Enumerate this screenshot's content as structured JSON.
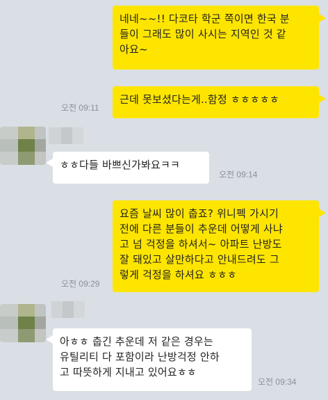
{
  "messages": [
    {
      "sender": "me",
      "text": "네네~~!! 다코타 학군 쪽이면 한국 분\n들이 그래도 많이 사시는 지역인 것 같\n아요~",
      "time": ""
    },
    {
      "sender": "me",
      "text": "근데 못보셨다는게..함정 ㅎㅎㅎㅎㅎ",
      "time": "오전 09:11"
    },
    {
      "sender": "them",
      "text": "ㅎㅎ다들 바쁘신가봐요ㅋㅋ",
      "time": "오전 09:14"
    },
    {
      "sender": "me",
      "text": "요즘 날씨 많이 춥죠? 위니펙 가시기\n전에 다른 분들이 추운데 어떻게 사냐\n고 넘 걱정을 하셔서~ 아파트 난방도\n잘 돼있고 살만하다고 안내드려도 그\n렇게 걱정을 하셔요 ㅎㅎㅎ",
      "time": "오전 09:29"
    },
    {
      "sender": "them",
      "text": "아ㅎㅎ 춥긴 추운데 저 같은 경우는\n유틸리티 다 포함이라 난방걱정 안하\n고 따뜻하게 지내고 있어요ㅎㅎ",
      "time": "오전 09:34"
    }
  ],
  "colors": {
    "background": "#d9dfe4",
    "my_bubble": "#fee500",
    "their_bubble": "#ffffff",
    "text": "#222222",
    "timestamp": "#8a9097"
  }
}
